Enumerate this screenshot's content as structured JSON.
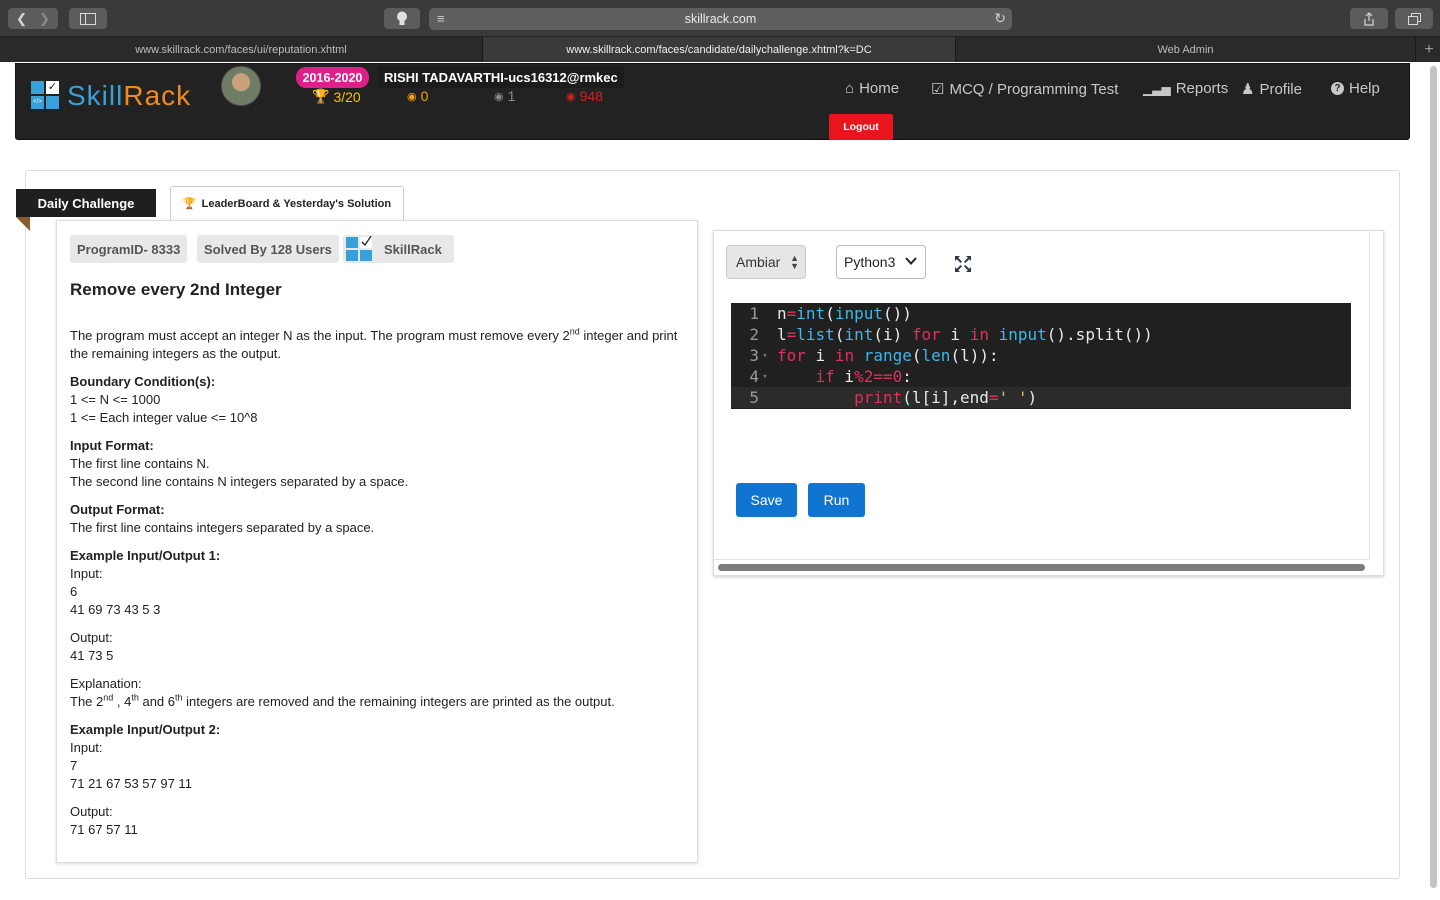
{
  "browser": {
    "address": "skillrack.com",
    "tabs": [
      {
        "label": "www.skillrack.com/faces/ui/reputation.xhtml",
        "active": false
      },
      {
        "label": "www.skillrack.com/faces/candidate/dailychallenge.xhtml?k=DC",
        "active": true
      },
      {
        "label": "Web Admin",
        "active": false
      }
    ]
  },
  "header": {
    "logo": {
      "skill": "Skill",
      "rack": "Rack"
    },
    "batch": "2016-2020",
    "username": "RISHI TADAVARTHI-ucs16312@rmkec",
    "stats": {
      "trophy": "3/20",
      "gold": "0",
      "silver": "1",
      "bronze": "948"
    },
    "nav": [
      {
        "label": "Home",
        "icon": "home-icon"
      },
      {
        "label": "MCQ / Programming Test",
        "icon": "checkbox-icon"
      },
      {
        "label": "Reports",
        "icon": "bar-chart-icon"
      },
      {
        "label": "Profile",
        "icon": "user-icon"
      },
      {
        "label": "Help",
        "icon": "question-icon"
      }
    ],
    "logout": "Logout"
  },
  "tabs": {
    "daily": "Daily Challenge",
    "leaderboard": "LeaderBoard & Yesterday's Solution"
  },
  "problem": {
    "program_id": "ProgramID- 8333",
    "solved_by": "Solved By 128 Users",
    "source": "SkillRack",
    "title": "Remove every 2nd Integer",
    "intro_a": "The program must accept an integer N as the input. The program must remove every 2",
    "intro_sup": "nd",
    "intro_b": " integer and print the remaining integers as the output.",
    "boundary_heading": "Boundary Condition(s):",
    "boundary_1": "1 <= N <= 1000",
    "boundary_2": "1 <= Each integer value <= 10^8",
    "input_heading": "Input Format:",
    "input_1": "The first line contains N.",
    "input_2": "The second line contains N integers separated by a space.",
    "output_heading": "Output Format:",
    "output_1": "The first line contains integers separated by a space.",
    "ex1_heading": "Example Input/Output 1:",
    "ex1_input_label": "Input:",
    "ex1_input_1": "6",
    "ex1_input_2": "41 69 73 43 5 3",
    "ex1_output_label": "Output:",
    "ex1_output_1": "41 73 5",
    "explanation_label": "Explanation:",
    "exp_a": "The 2",
    "exp_sup1": "nd",
    "exp_b": " , 4",
    "exp_sup2": "th",
    "exp_c": " and 6",
    "exp_sup3": "th",
    "exp_d": " integers are removed and the remaining integers are printed as the output.",
    "ex2_heading": "Example Input/Output 2:",
    "ex2_input_label": "Input:",
    "ex2_input_1": "7",
    "ex2_input_2": "71 21 67 53 57 97 11",
    "ex2_output_label": "Output:",
    "ex2_output_1": "71 67 57 11"
  },
  "editor": {
    "theme": "Ambiar",
    "language": "Python3",
    "line_numbers": [
      "1",
      "2",
      "3",
      "4",
      "5"
    ],
    "save": "Save",
    "run": "Run"
  },
  "colors": {
    "brand_blue": "#3aa0d8",
    "brand_orange": "#f08a24",
    "button_blue": "#0f75d1",
    "logout_red": "#e8151c",
    "batch_pink": "#e0208a"
  }
}
